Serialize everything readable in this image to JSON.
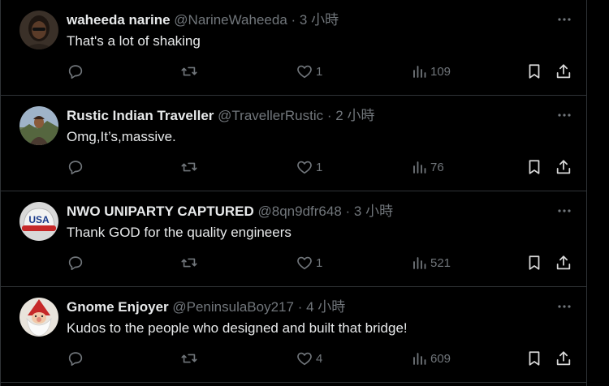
{
  "tweets": [
    {
      "name": "waheeda narine",
      "handle": "@NarineWaheeda",
      "dot": "·",
      "time": "3 小時",
      "text": "That's a lot of shaking",
      "likes": "1",
      "views": "109",
      "avatar": "dark-portrait"
    },
    {
      "name": "Rustic Indian Traveller",
      "handle": "@TravellerRustic",
      "dot": "·",
      "time": "2 小時",
      "text": "Omg,It’s,massive.",
      "likes": "1",
      "views": "76",
      "avatar": "traveller-photo"
    },
    {
      "name": "NWO UNIPARTY CAPTURED",
      "handle": "@8qn9dfr648",
      "dot": "·",
      "time": "3 小時",
      "text": "Thank GOD for the quality engineers",
      "likes": "1",
      "views": "521",
      "avatar": "usa-cap"
    },
    {
      "name": "Gnome Enjoyer",
      "handle": "@PeninsulaBoy217",
      "dot": "·",
      "time": "4 小時",
      "text": "Kudos to the people who designed and built that bridge!",
      "likes": "4",
      "views": "609",
      "avatar": "gnome"
    }
  ],
  "colors": {
    "background": "#000000",
    "text_primary": "#e7e9ea",
    "text_secondary": "#71767b",
    "divider": "#2f3336"
  },
  "icons": [
    "reply-icon",
    "retweet-icon",
    "like-icon",
    "views-icon",
    "bookmark-icon",
    "share-icon",
    "more-icon"
  ]
}
